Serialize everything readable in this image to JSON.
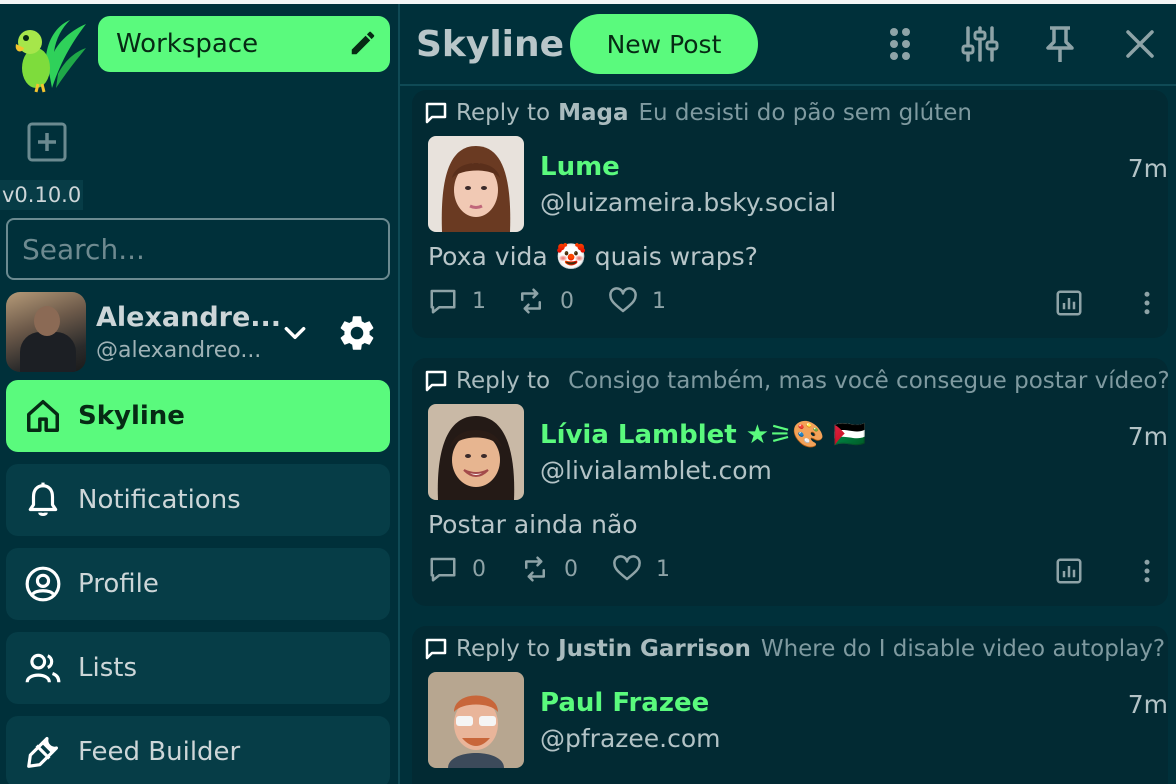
{
  "sidebar": {
    "workspace_label": "Workspace",
    "version": "v0.10.0",
    "search_placeholder": "Search...",
    "account": {
      "name": "Alexandre...",
      "handle": "@alexandreo..."
    },
    "nav": [
      {
        "label": "Skyline",
        "icon": "home-icon",
        "active": true
      },
      {
        "label": "Notifications",
        "icon": "bell-icon",
        "active": false
      },
      {
        "label": "Profile",
        "icon": "user-circle-icon",
        "active": false
      },
      {
        "label": "Lists",
        "icon": "users-icon",
        "active": false
      },
      {
        "label": "Feed Builder",
        "icon": "tools-icon",
        "active": false
      }
    ]
  },
  "main": {
    "title": "Skyline",
    "new_post_label": "New Post",
    "header_icons": [
      "grid-dots-icon",
      "sliders-icon",
      "pin-icon",
      "close-icon"
    ]
  },
  "posts": [
    {
      "reply_prefix": "Reply to",
      "reply_name": "Maga",
      "reply_text": "Eu desisti do pão sem glúten",
      "author": "Lume",
      "handle": "@luizameira.bsky.social",
      "time": "7m",
      "text": "Poxa vida 🤡 quais wraps?",
      "replies": "1",
      "reposts": "0",
      "likes": "1"
    },
    {
      "reply_prefix": "Reply to",
      "reply_name": "",
      "reply_text": "Consigo também, mas você consegue postar vídeo?",
      "author": "Lívia Lamblet ★⚞🎨 🇵🇸",
      "handle": "@livialamblet.com",
      "time": "7m",
      "text": "Postar ainda não",
      "replies": "0",
      "reposts": "0",
      "likes": "1"
    },
    {
      "reply_prefix": "Reply to",
      "reply_name": "Justin Garrison",
      "reply_text": "Where do I disable video autoplay?",
      "author": "Paul Frazee",
      "handle": "@pfrazee.com",
      "time": "7m",
      "text": "",
      "replies": "",
      "reposts": "",
      "likes": ""
    }
  ],
  "colors": {
    "background": "#00303a",
    "accent": "#5afa7d",
    "card": "#022a33",
    "nav_item": "#063d47"
  }
}
